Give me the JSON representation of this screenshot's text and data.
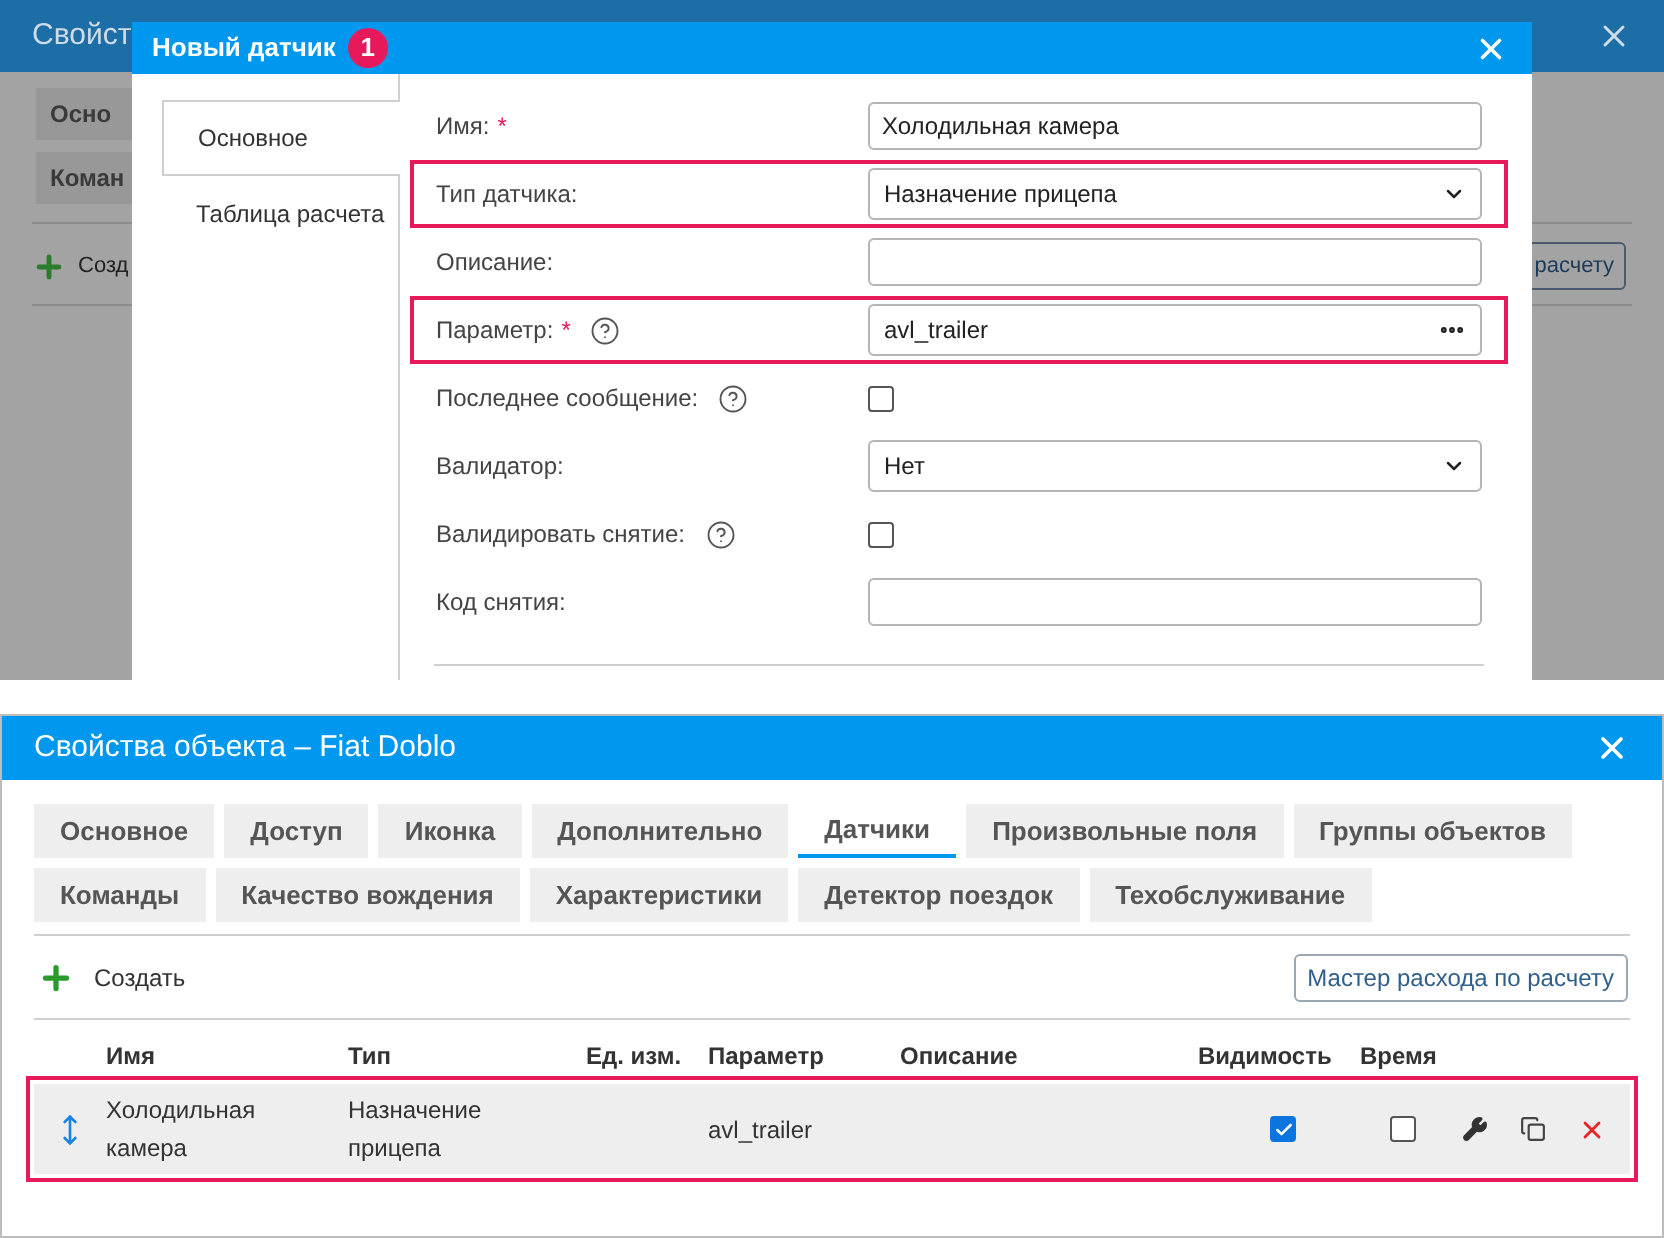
{
  "background_window": {
    "title": "Свойст",
    "tabs": [
      {
        "label": "Осно"
      },
      {
        "label": "Коман"
      }
    ],
    "create_button": "Созд",
    "wizard_button": "расчету"
  },
  "dialog": {
    "title": "Новый датчик",
    "callout": "1",
    "tabs": [
      {
        "label": "Основное",
        "selected": true
      },
      {
        "label": "Таблица расчета",
        "selected": false
      }
    ],
    "fields": [
      {
        "kind": "text",
        "label": "Имя:",
        "required_mark": "*",
        "help": false,
        "highlighted": false,
        "value": "Холодильная камера"
      },
      {
        "kind": "select",
        "label": "Тип датчика:",
        "help": false,
        "highlighted": true,
        "value": "Назначение прицепа"
      },
      {
        "kind": "text",
        "label": "Описание:",
        "help": false,
        "highlighted": false
      },
      {
        "kind": "picker",
        "label": "Параметр:",
        "required_mark": "*",
        "help": true,
        "highlighted": true,
        "value": "avl_trailer"
      },
      {
        "kind": "checkbox",
        "label": "Последнее сообщение:",
        "help": true,
        "highlighted": false,
        "checked": false
      },
      {
        "kind": "select",
        "label": "Валидатор:",
        "help": false,
        "highlighted": false,
        "value": "Нет"
      },
      {
        "kind": "checkbox",
        "label": "Валидировать снятие:",
        "help": true,
        "highlighted": false,
        "checked": false
      },
      {
        "kind": "text",
        "label": "Код снятия:",
        "help": false,
        "highlighted": false
      }
    ]
  },
  "object_window": {
    "title": "Свойства объекта – Fiat Doblo",
    "tabs": [
      [
        {
          "label": "Основное",
          "selected": false
        },
        {
          "label": "Доступ",
          "selected": false
        },
        {
          "label": "Иконка",
          "selected": false
        },
        {
          "label": "Дополнительно",
          "selected": false
        },
        {
          "label": "Датчики",
          "selected": true
        },
        {
          "label": "Произвольные поля",
          "selected": false
        },
        {
          "label": "Группы объектов",
          "selected": false
        }
      ],
      [
        {
          "label": "Команды",
          "selected": false
        },
        {
          "label": "Качество вождения",
          "selected": false
        },
        {
          "label": "Характеристики",
          "selected": false
        },
        {
          "label": "Детектор поездок",
          "selected": false
        },
        {
          "label": "Техобслуживание",
          "selected": false
        }
      ]
    ],
    "create_button": "Создать",
    "wizard_button": "Мастер расхода по расчету",
    "table": {
      "columns": [
        "Имя",
        "Тип",
        "Ед. изм.",
        "Параметр",
        "Описание",
        "Видимость",
        "Время"
      ],
      "rows": [
        {
          "name": "Холодильная камера",
          "type": "Назначение прицепа",
          "parameter": "avl_trailer",
          "visible": true,
          "time": false,
          "highlighted": true
        }
      ]
    }
  }
}
